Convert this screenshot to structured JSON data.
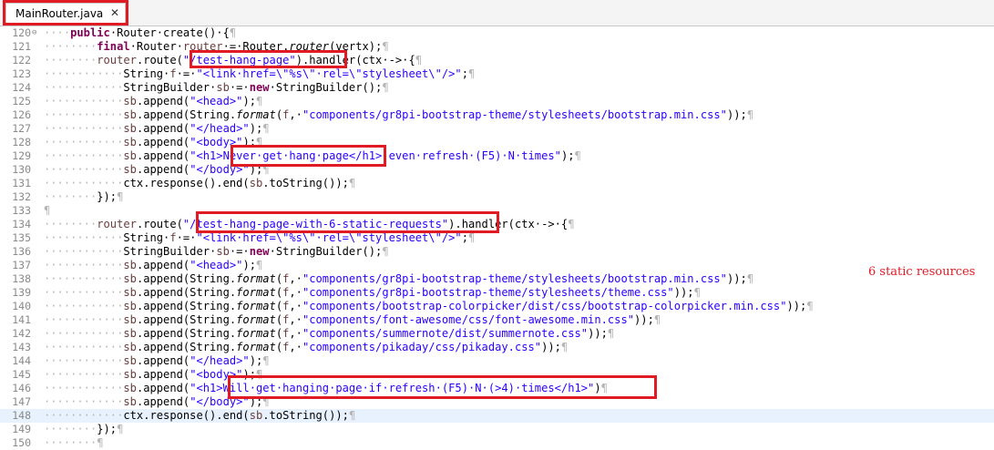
{
  "tab": {
    "title": "MainRouter.java",
    "close_icon": "x-close-icon"
  },
  "annotation": "6 static resources",
  "lines": [
    {
      "n": "120",
      "fold": "⊖",
      "segs": [
        [
          "ws",
          "····"
        ],
        [
          "kw",
          "public"
        ],
        [
          "",
          "·Router·create()·{"
        ],
        [
          "pil",
          "¶"
        ]
      ]
    },
    {
      "n": "121",
      "segs": [
        [
          "ws",
          "········"
        ],
        [
          "kw",
          "final"
        ],
        [
          "",
          "·Router·"
        ],
        [
          "var",
          "router"
        ],
        [
          "",
          "·=·Router."
        ],
        [
          "it",
          "router"
        ],
        [
          "",
          "(vertx);"
        ],
        [
          "pil",
          "¶"
        ]
      ]
    },
    {
      "n": "122",
      "segs": [
        [
          "ws",
          "········"
        ],
        [
          "var",
          "router"
        ],
        [
          "",
          ".route("
        ],
        [
          "str",
          "\"/test-hang-page\""
        ],
        [
          "",
          ").handler(ctx·->·{"
        ],
        [
          "pil",
          "¶"
        ]
      ]
    },
    {
      "n": "123",
      "segs": [
        [
          "ws",
          "············"
        ],
        [
          "",
          "String·"
        ],
        [
          "var",
          "f"
        ],
        [
          "",
          "·=·"
        ],
        [
          "str",
          "\"<link·href=\\\"%s\\\"·rel=\\\"stylesheet\\\"/>\""
        ],
        [
          "",
          ";"
        ],
        [
          "pil",
          "¶"
        ]
      ]
    },
    {
      "n": "124",
      "segs": [
        [
          "ws",
          "············"
        ],
        [
          "",
          "StringBuilder·"
        ],
        [
          "var",
          "sb"
        ],
        [
          "",
          "·=·"
        ],
        [
          "kw",
          "new"
        ],
        [
          "",
          "·StringBuilder();"
        ],
        [
          "pil",
          "¶"
        ]
      ]
    },
    {
      "n": "125",
      "segs": [
        [
          "ws",
          "············"
        ],
        [
          "var",
          "sb"
        ],
        [
          "",
          ".append("
        ],
        [
          "str",
          "\"<head>\""
        ],
        [
          "",
          ");"
        ],
        [
          "pil",
          "¶"
        ]
      ]
    },
    {
      "n": "126",
      "segs": [
        [
          "ws",
          "············"
        ],
        [
          "var",
          "sb"
        ],
        [
          "",
          ".append(String."
        ],
        [
          "it",
          "format"
        ],
        [
          "",
          "("
        ],
        [
          "var",
          "f"
        ],
        [
          "",
          ",·"
        ],
        [
          "str",
          "\"components/gr8pi-bootstrap-theme/stylesheets/bootstrap.min.css\""
        ],
        [
          "",
          "));"
        ],
        [
          "pil",
          "¶"
        ]
      ]
    },
    {
      "n": "127",
      "segs": [
        [
          "ws",
          "············"
        ],
        [
          "var",
          "sb"
        ],
        [
          "",
          ".append("
        ],
        [
          "str",
          "\"</head>\""
        ],
        [
          "",
          ");"
        ],
        [
          "pil",
          "¶"
        ]
      ]
    },
    {
      "n": "128",
      "segs": [
        [
          "ws",
          "············"
        ],
        [
          "var",
          "sb"
        ],
        [
          "",
          ".append("
        ],
        [
          "str",
          "\"<body>\""
        ],
        [
          "",
          ");"
        ],
        [
          "pil",
          "¶"
        ]
      ]
    },
    {
      "n": "129",
      "segs": [
        [
          "ws",
          "············"
        ],
        [
          "var",
          "sb"
        ],
        [
          "",
          ".append("
        ],
        [
          "str",
          "\"<h1>Never·get·hang·page</h1>·even·refresh·(F5)·N·times\""
        ],
        [
          "",
          ");"
        ],
        [
          "pil",
          "¶"
        ]
      ]
    },
    {
      "n": "130",
      "segs": [
        [
          "ws",
          "············"
        ],
        [
          "var",
          "sb"
        ],
        [
          "",
          ".append("
        ],
        [
          "str",
          "\"</body>\""
        ],
        [
          "",
          ");"
        ],
        [
          "pil",
          "¶"
        ]
      ]
    },
    {
      "n": "131",
      "segs": [
        [
          "ws",
          "············"
        ],
        [
          "",
          "ctx.response().end("
        ],
        [
          "var",
          "sb"
        ],
        [
          "",
          ".toString());"
        ],
        [
          "pil",
          "¶"
        ]
      ]
    },
    {
      "n": "132",
      "segs": [
        [
          "ws",
          "········"
        ],
        [
          "",
          "});"
        ],
        [
          "pil",
          "¶"
        ]
      ]
    },
    {
      "n": "133",
      "segs": [
        [
          "pil",
          "¶"
        ]
      ]
    },
    {
      "n": "134",
      "segs": [
        [
          "ws",
          "········"
        ],
        [
          "var",
          "router"
        ],
        [
          "",
          ".route("
        ],
        [
          "str",
          "\"/test-hang-page-with-6-static-requests\""
        ],
        [
          "",
          ").handler(ctx·->·{"
        ],
        [
          "pil",
          "¶"
        ]
      ]
    },
    {
      "n": "135",
      "segs": [
        [
          "ws",
          "············"
        ],
        [
          "",
          "String·"
        ],
        [
          "var",
          "f"
        ],
        [
          "",
          "·=·"
        ],
        [
          "str",
          "\"<link·href=\\\"%s\\\"·rel=\\\"stylesheet\\\"/>\""
        ],
        [
          "",
          ";"
        ],
        [
          "pil",
          "¶"
        ]
      ]
    },
    {
      "n": "136",
      "segs": [
        [
          "ws",
          "············"
        ],
        [
          "",
          "StringBuilder·"
        ],
        [
          "var",
          "sb"
        ],
        [
          "",
          "·=·"
        ],
        [
          "kw",
          "new"
        ],
        [
          "",
          "·StringBuilder();"
        ],
        [
          "pil",
          "¶"
        ]
      ]
    },
    {
      "n": "137",
      "segs": [
        [
          "ws",
          "············"
        ],
        [
          "var",
          "sb"
        ],
        [
          "",
          ".append("
        ],
        [
          "str",
          "\"<head>\""
        ],
        [
          "",
          ");"
        ],
        [
          "pil",
          "¶"
        ]
      ]
    },
    {
      "n": "138",
      "segs": [
        [
          "ws",
          "············"
        ],
        [
          "var",
          "sb"
        ],
        [
          "",
          ".append(String."
        ],
        [
          "it",
          "format"
        ],
        [
          "",
          "("
        ],
        [
          "var",
          "f"
        ],
        [
          "",
          ",·"
        ],
        [
          "str",
          "\"components/gr8pi-bootstrap-theme/stylesheets/bootstrap.min.css\""
        ],
        [
          "",
          "));"
        ],
        [
          "pil",
          "¶"
        ]
      ]
    },
    {
      "n": "139",
      "segs": [
        [
          "ws",
          "············"
        ],
        [
          "var",
          "sb"
        ],
        [
          "",
          ".append(String."
        ],
        [
          "it",
          "format"
        ],
        [
          "",
          "("
        ],
        [
          "var",
          "f"
        ],
        [
          "",
          ",·"
        ],
        [
          "str",
          "\"components/gr8pi-bootstrap-theme/stylesheets/theme.css\""
        ],
        [
          "",
          "));"
        ],
        [
          "pil",
          "¶"
        ]
      ]
    },
    {
      "n": "140",
      "segs": [
        [
          "ws",
          "············"
        ],
        [
          "var",
          "sb"
        ],
        [
          "",
          ".append(String."
        ],
        [
          "it",
          "format"
        ],
        [
          "",
          "("
        ],
        [
          "var",
          "f"
        ],
        [
          "",
          ",·"
        ],
        [
          "str",
          "\"components/bootstrap-colorpicker/dist/css/bootstrap-colorpicker.min.css\""
        ],
        [
          "",
          "));"
        ],
        [
          "pil",
          "¶"
        ]
      ]
    },
    {
      "n": "141",
      "segs": [
        [
          "ws",
          "············"
        ],
        [
          "var",
          "sb"
        ],
        [
          "",
          ".append(String."
        ],
        [
          "it",
          "format"
        ],
        [
          "",
          "("
        ],
        [
          "var",
          "f"
        ],
        [
          "",
          ",·"
        ],
        [
          "str",
          "\"components/font-awesome/css/font-awesome.min.css\""
        ],
        [
          "",
          "));"
        ],
        [
          "pil",
          "¶"
        ]
      ]
    },
    {
      "n": "142",
      "segs": [
        [
          "ws",
          "············"
        ],
        [
          "var",
          "sb"
        ],
        [
          "",
          ".append(String."
        ],
        [
          "it",
          "format"
        ],
        [
          "",
          "("
        ],
        [
          "var",
          "f"
        ],
        [
          "",
          ",·"
        ],
        [
          "str",
          "\"components/summernote/dist/summernote.css\""
        ],
        [
          "",
          "));"
        ],
        [
          "pil",
          "¶"
        ]
      ]
    },
    {
      "n": "143",
      "segs": [
        [
          "ws",
          "············"
        ],
        [
          "var",
          "sb"
        ],
        [
          "",
          ".append(String."
        ],
        [
          "it",
          "format"
        ],
        [
          "",
          "("
        ],
        [
          "var",
          "f"
        ],
        [
          "",
          ",·"
        ],
        [
          "str",
          "\"components/pikaday/css/pikaday.css\""
        ],
        [
          "",
          "));"
        ],
        [
          "pil",
          "¶"
        ]
      ]
    },
    {
      "n": "144",
      "segs": [
        [
          "ws",
          "············"
        ],
        [
          "var",
          "sb"
        ],
        [
          "",
          ".append("
        ],
        [
          "str",
          "\"</head>\""
        ],
        [
          "",
          ");"
        ],
        [
          "pil",
          "¶"
        ]
      ]
    },
    {
      "n": "145",
      "segs": [
        [
          "ws",
          "············"
        ],
        [
          "var",
          "sb"
        ],
        [
          "",
          ".append("
        ],
        [
          "str",
          "\"<body>\""
        ],
        [
          "",
          ");"
        ],
        [
          "pil",
          "¶"
        ]
      ]
    },
    {
      "n": "146",
      "segs": [
        [
          "ws",
          "············"
        ],
        [
          "var",
          "sb"
        ],
        [
          "",
          ".append("
        ],
        [
          "str",
          "\"<h1>Will·get·hanging·page·if·refresh·(F5)·N·(>4)·times</h1>\""
        ],
        [
          "",
          ")"
        ],
        [
          "pil",
          "¶"
        ]
      ]
    },
    {
      "n": "147",
      "segs": [
        [
          "ws",
          "············"
        ],
        [
          "var",
          "sb"
        ],
        [
          "",
          ".append("
        ],
        [
          "str",
          "\"</body>\""
        ],
        [
          "",
          ");"
        ],
        [
          "pil",
          "¶"
        ]
      ]
    },
    {
      "n": "148",
      "hl": true,
      "segs": [
        [
          "ws",
          "············"
        ],
        [
          "",
          "ctx.response().end("
        ],
        [
          "var",
          "sb"
        ],
        [
          "",
          ".toString());"
        ],
        [
          "pil",
          "¶"
        ]
      ]
    },
    {
      "n": "149",
      "segs": [
        [
          "ws",
          "········"
        ],
        [
          "",
          "});"
        ],
        [
          "pil",
          "¶"
        ]
      ]
    },
    {
      "n": "150",
      "segs": [
        [
          "ws",
          "········"
        ],
        [
          "pil",
          "¶"
        ]
      ]
    }
  ]
}
